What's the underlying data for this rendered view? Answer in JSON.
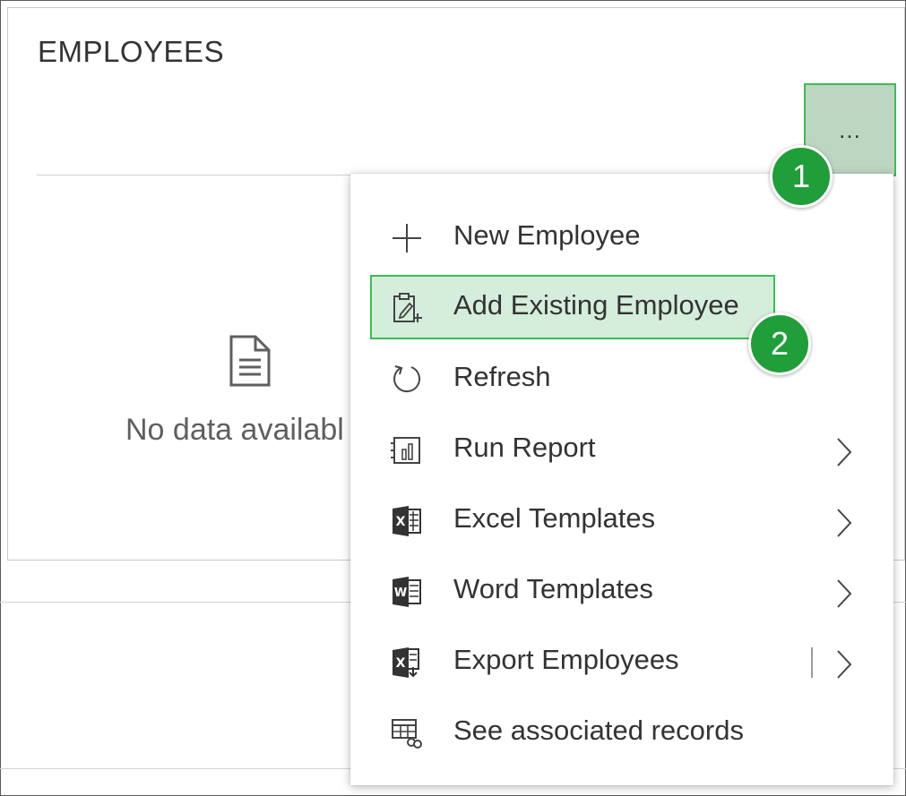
{
  "card": {
    "title": "EMPLOYEES",
    "empty_text": "No data availabl"
  },
  "more_button": {
    "label": "…"
  },
  "menu": {
    "items": [
      {
        "label": "New Employee",
        "icon": "plus-icon"
      },
      {
        "label": "Add Existing Employee",
        "icon": "clipboard-add-icon"
      },
      {
        "label": "Refresh",
        "icon": "refresh-icon"
      },
      {
        "label": "Run Report",
        "icon": "report-icon",
        "submenu": true
      },
      {
        "label": "Excel Templates",
        "icon": "excel-icon",
        "submenu": true
      },
      {
        "label": "Word Templates",
        "icon": "word-icon",
        "submenu": true
      },
      {
        "label": "Export Employees",
        "icon": "export-excel-icon",
        "submenu": true
      },
      {
        "label": "See associated records",
        "icon": "associated-records-icon"
      }
    ]
  },
  "callouts": [
    {
      "label": "1"
    },
    {
      "label": "2"
    }
  ],
  "colors": {
    "highlight_fill": "#d5eddb",
    "highlight_border": "#3dbb54",
    "badge": "#1f9e3a",
    "more_button_fill": "#bdd6c2"
  }
}
